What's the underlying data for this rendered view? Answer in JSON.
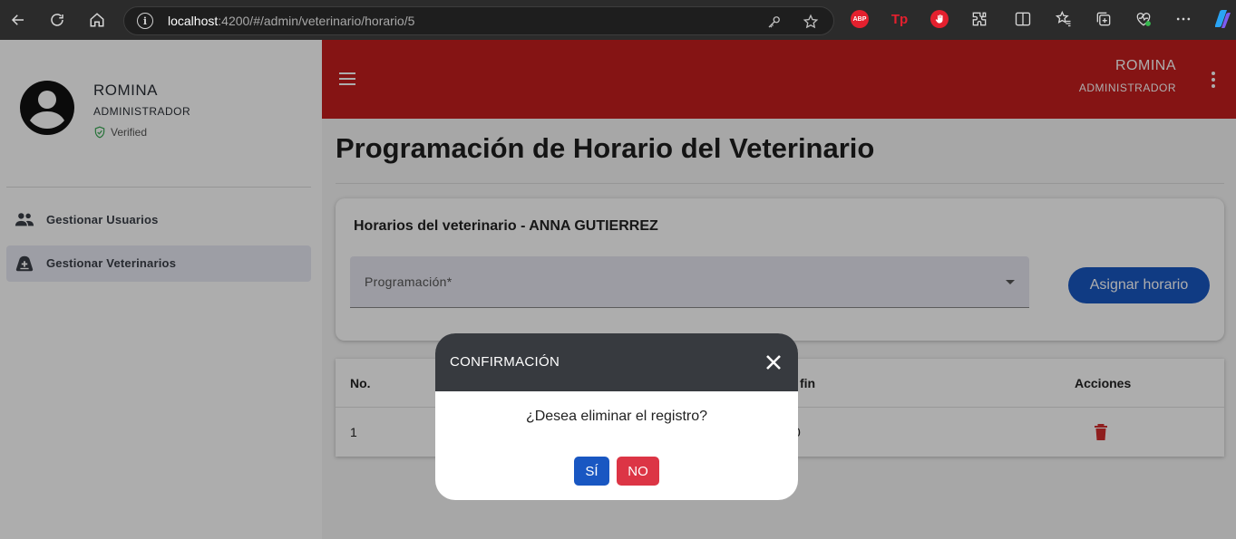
{
  "browser": {
    "url_host": "localhost",
    "url_path": ":4200/#/admin/veterinario/horario/5",
    "extensions": {
      "abp_label": "ABP",
      "tp_label": "Tp"
    }
  },
  "sidebar": {
    "user_name": "ROMINA",
    "user_role": "ADMINISTRADOR",
    "verified_label": "Verified",
    "items": [
      {
        "label": "Gestionar Usuarios",
        "icon": "people-icon"
      },
      {
        "label": "Gestionar Veterinarios",
        "icon": "medical-bag-icon",
        "active": true
      }
    ]
  },
  "header": {
    "user_name": "ROMINA",
    "user_role": "ADMINISTRADOR",
    "bar_color": "#c41e1e"
  },
  "main": {
    "page_title": "Programación de Horario del Veterinario",
    "card": {
      "title": "Horarios del veterinario - ANNA GUTIERREZ",
      "select_label": "Programación*",
      "assign_button": "Asignar horario"
    },
    "table": {
      "columns": {
        "no": "No.",
        "fin_partial": "fin",
        "acciones": "Acciones"
      },
      "rows": [
        {
          "no": "1",
          "fin_partial": "0"
        }
      ]
    }
  },
  "modal": {
    "title": "CONFIRMACIÓN",
    "message": "¿Desea eliminar el registro?",
    "yes_label": "SÍ",
    "no_label": "NO"
  },
  "colors": {
    "primary": "#1957c2",
    "danger": "#dc3545",
    "header_red": "#c41e1e",
    "modal_header": "#373a3f"
  }
}
